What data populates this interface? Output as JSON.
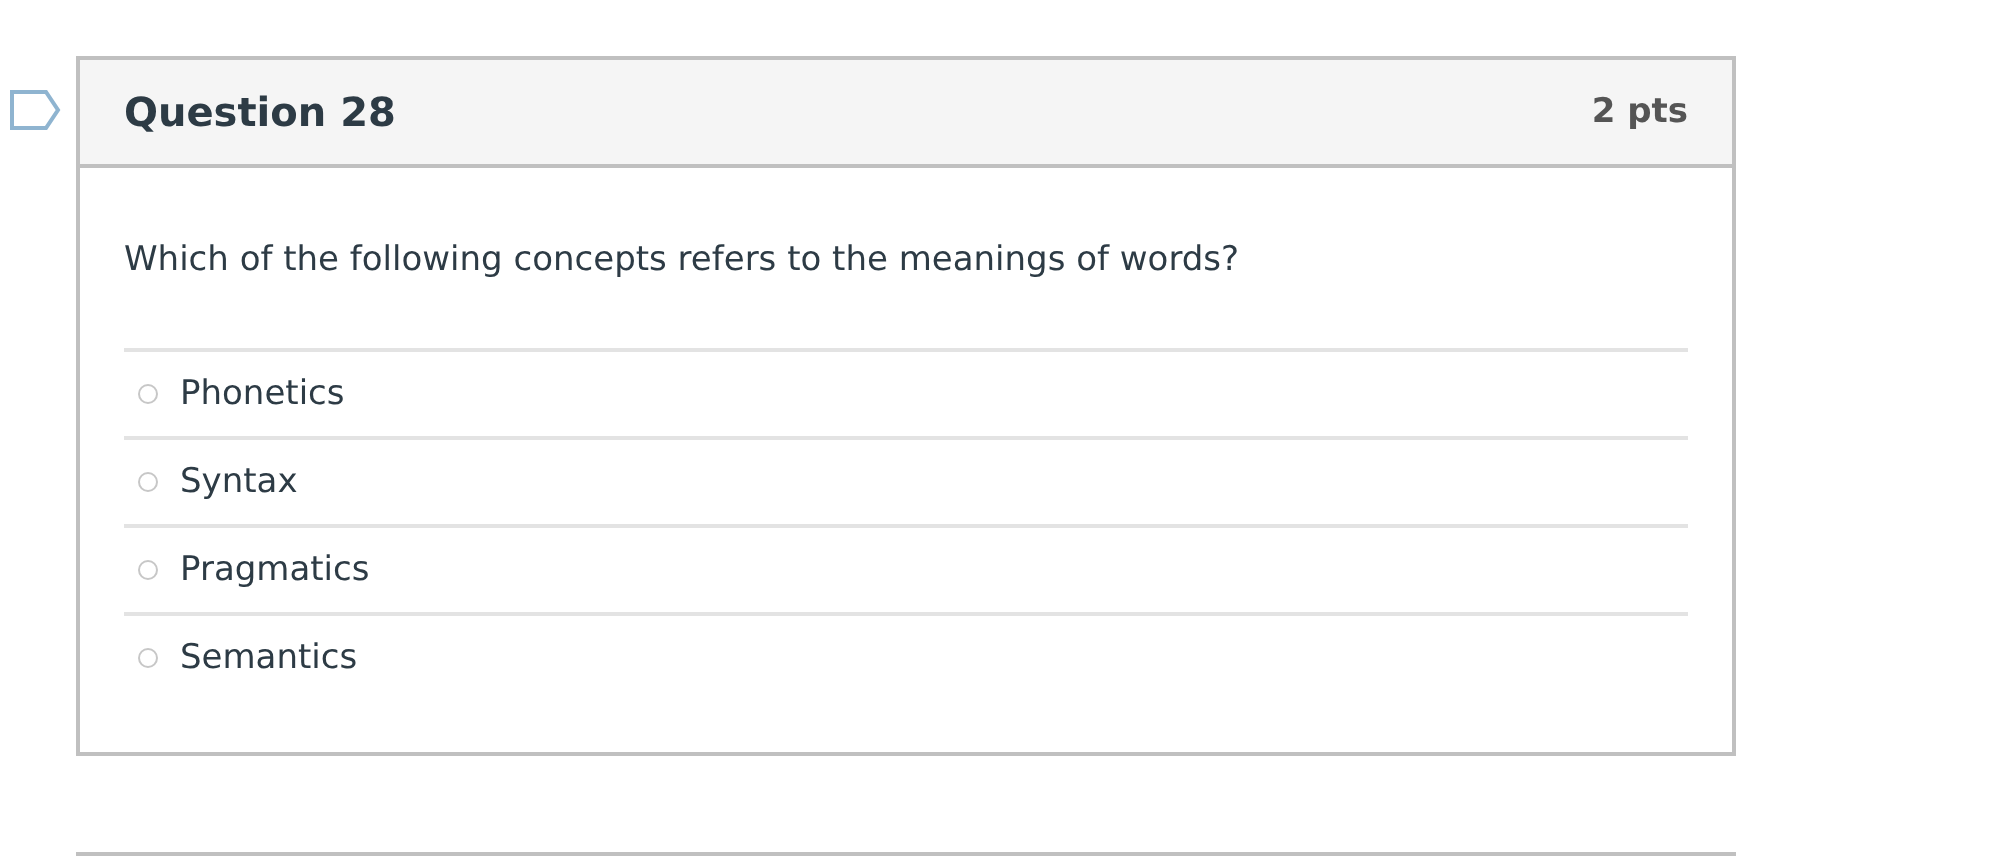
{
  "question": {
    "title": "Question 28",
    "points": "2 pts",
    "text": "Which of the following concepts refers to the meanings of words?",
    "answers": [
      {
        "label": "Phonetics",
        "selected": false
      },
      {
        "label": "Syntax",
        "selected": false
      },
      {
        "label": "Pragmatics",
        "selected": false
      },
      {
        "label": "Semantics",
        "selected": false
      }
    ]
  }
}
